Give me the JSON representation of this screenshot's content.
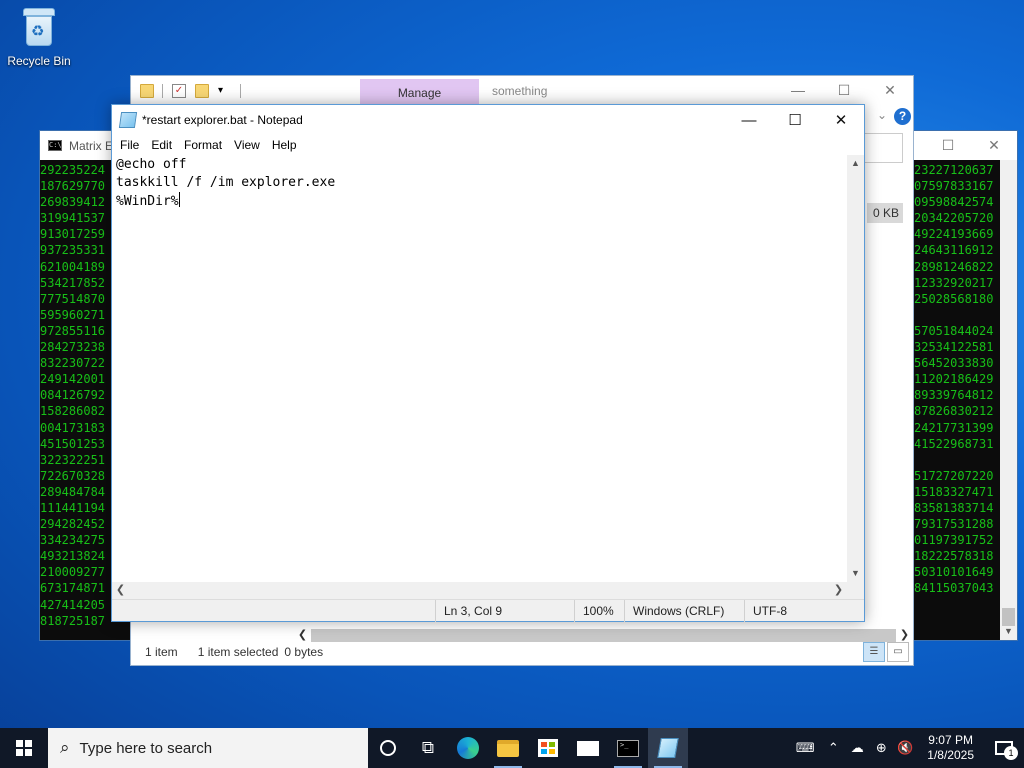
{
  "desktop": {
    "recycle_bin_label": "Recycle Bin"
  },
  "console": {
    "title": "Matrix E",
    "left_lines": [
      "292235224",
      "187629770",
      "269839412",
      "319941537",
      "913017259",
      "937235331",
      "621004189",
      "534217852",
      "777514870",
      "595960271",
      "972855116",
      "284273238",
      "832230722",
      "249142001",
      "084126792",
      "158286082",
      "004173183",
      "451501253",
      "322322251",
      "722670328",
      "289484784",
      "111441194",
      "294282452",
      "334234275",
      "493213824",
      "210009277",
      "673174871",
      "427414205",
      "818725187"
    ],
    "right_lines": [
      "23227120637",
      "07597833167",
      "09598842574",
      "20342205720",
      "49224193669",
      "24643116912",
      "28981246822",
      "12332920217",
      "25028568180",
      "",
      "57051844024",
      "32534122581",
      "56452033830",
      "11202186429",
      "89339764812",
      "87826830212",
      "24217731399",
      "41522968731",
      "",
      "51727207220",
      "15183327471",
      "83581383714",
      "79317531288",
      "01197391752",
      "18222578318",
      "50310101649",
      "84115037043"
    ]
  },
  "explorer": {
    "manage_tab": "Manage",
    "context_title": "something",
    "size_value": "0 KB",
    "status": {
      "items": "1 item",
      "selected": "1 item selected",
      "size": "0 bytes"
    }
  },
  "notepad": {
    "title": "*restart explorer.bat - Notepad",
    "menu": [
      "File",
      "Edit",
      "Format",
      "View",
      "Help"
    ],
    "lines": [
      "@echo off",
      "taskkill /f /im explorer.exe",
      "%WinDir%"
    ],
    "status": {
      "position": "Ln 3, Col 9",
      "zoom": "100%",
      "line_ending": "Windows (CRLF)",
      "encoding": "UTF-8"
    }
  },
  "taskbar": {
    "search_placeholder": "Type here to search",
    "time": "9:07 PM",
    "date": "1/8/2025",
    "notification_count": "1",
    "pinned": [
      "cortana-icon",
      "task-view-icon",
      "edge-icon",
      "file-explorer-icon",
      "store-icon",
      "mail-icon",
      "terminal-icon",
      "notepad-icon"
    ]
  },
  "colors": {
    "matrix_green": "#18c018",
    "manage_tab": "#e1c6f2",
    "taskbar": "#101827"
  }
}
